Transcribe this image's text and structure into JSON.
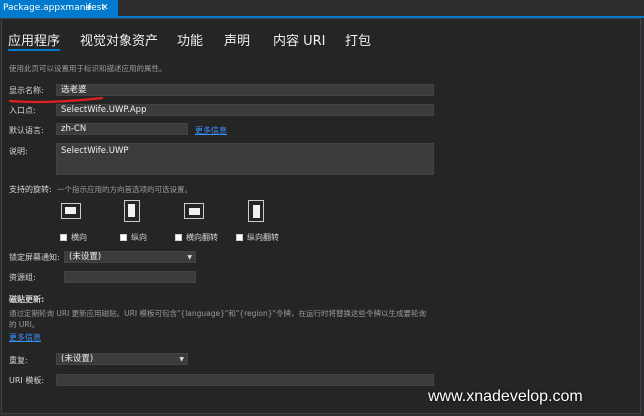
{
  "document_tab": {
    "title": "Package.appxmanifest",
    "pin_icon": "pin-icon",
    "close_icon": "close-icon"
  },
  "nav": {
    "tabs": [
      {
        "label": "应用程序"
      },
      {
        "label": "视觉对象资产"
      },
      {
        "label": "功能"
      },
      {
        "label": "声明"
      },
      {
        "label": "内容 URI"
      },
      {
        "label": "打包"
      }
    ]
  },
  "description": "使用此页可以设置用于标识和描述应用的属性。",
  "display_name": {
    "label": "显示名称:",
    "value": "选老婆"
  },
  "entry_point": {
    "label": "入口点:",
    "value": "SelectWife.UWP.App"
  },
  "default_language": {
    "label": "默认语言:",
    "value": "zh-CN",
    "link": "更多信息"
  },
  "app_description": {
    "label": "说明:",
    "value": "SelectWife.UWP"
  },
  "rotation": {
    "label": "支持的旋转:",
    "hint": "一个指示应用的方向首选项的可选设置。",
    "options": [
      {
        "label": "横向",
        "icon": "landscape-icon"
      },
      {
        "label": "纵向",
        "icon": "portrait-icon"
      },
      {
        "label": "横向翻转",
        "icon": "landscape-flipped-icon"
      },
      {
        "label": "纵向翻转",
        "icon": "portrait-flipped-icon"
      }
    ]
  },
  "lock_screen": {
    "label": "锁定屏幕通知:",
    "value": "(未设置)"
  },
  "resource_group": {
    "label": "资源组:",
    "value": ""
  },
  "tile_update": {
    "heading": "磁贴更新:",
    "desc_line1": "通过定期轮询 URI 更新应用磁贴。URI 模板可包含\"{language}\"和\"{region}\"令牌，在运行时将替换这些令牌以生成要轮询",
    "desc_line2": "的 URI。",
    "link": "更多信息"
  },
  "recurrence": {
    "label": "重复:",
    "value": "(未设置)"
  },
  "uri_template": {
    "label": "URI 模板:",
    "value": ""
  },
  "watermark": "www.xnadevelop.com",
  "colors": {
    "accent": "#007acc",
    "annotation": "#e02020",
    "link": "#3794ff"
  }
}
